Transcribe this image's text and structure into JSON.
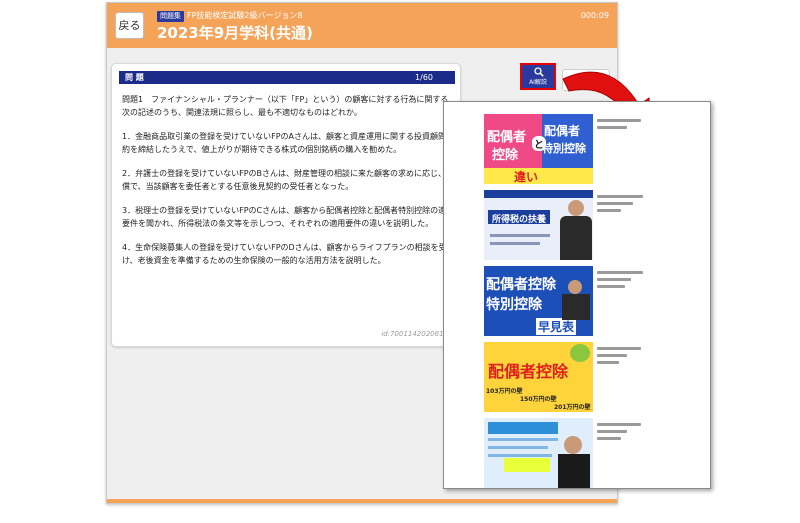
{
  "header": {
    "back_label": "戻る",
    "badge": "問題集",
    "subtitle": "FP技能検定試験2級バージョン8",
    "title": "2023年9月学科(共通)",
    "timer": "000:09"
  },
  "question": {
    "section_label": "問 題",
    "progress": "1/60",
    "stem": "問題1　ファイナンシャル・プランナー（以下「FP」という）の顧客に対する行為に関する次の記述のうち、関連法規に照らし、最も不適切なものはどれか。",
    "choices": [
      "1．金融商品取引業の登録を受けていないFPのAさんは、顧客と資産運用に関する投資顧問契約を締結したうえで、値上がりが期待できる株式の個別銘柄の購入を勧めた。",
      "2．弁護士の登録を受けていないFPのBさんは、財産管理の相談に来た顧客の求めに応じ、有償で、当該顧客を委任者とする任意後見契約の受任者となった。",
      "3．税理士の登録を受けていないFPのCさんは、顧客から配偶者控除と配偶者特別控除の適用要件を聞かれ、所得税法の条文等を示しつつ、それぞれの適用要件の違いを説明した。",
      "4．生命保険募集人の登録を受けていないFPのDさんは、顧客からライフプランの相談を受け、老後資金を準備するための生命保険の一般的な活用方法を説明した。"
    ],
    "id": "id:7001142020610"
  },
  "ai_button": {
    "label": "AI解説",
    "icon": "magnifier-icon"
  },
  "results": [
    {
      "thumb_lines": [
        "配偶者",
        "控除",
        "と",
        "配偶者",
        "特別控除",
        "違い"
      ],
      "colors": [
        "#f04a86",
        "#2f5fd0",
        "#ffe94a"
      ]
    },
    {
      "thumb_lines": [
        "所得税の扶養"
      ],
      "colors": [
        "#1c3f9e",
        "#e9eef8",
        "#2a2a2a"
      ]
    },
    {
      "thumb_lines": [
        "配偶者控除",
        "特別控除",
        "早見表"
      ],
      "colors": [
        "#1d4fb8",
        "#ffffff",
        "#f7e64b"
      ]
    },
    {
      "thumb_lines": [
        "配偶者控除",
        "103万円の壁",
        "150万円の壁",
        "201万円の壁"
      ],
      "colors": [
        "#ffd43a",
        "#e02020",
        "#ffffff"
      ]
    },
    {
      "thumb_lines": [],
      "colors": [
        "#2c8fd8",
        "#dfeefa",
        "#1a1a1a"
      ]
    }
  ]
}
